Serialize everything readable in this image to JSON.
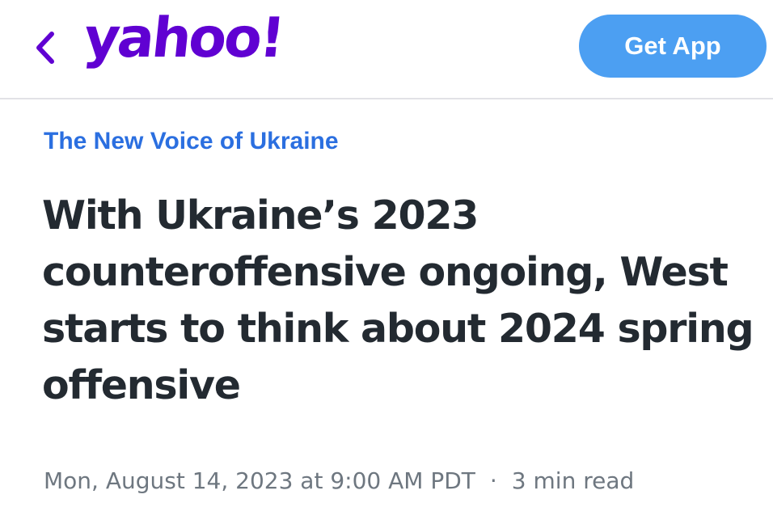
{
  "header": {
    "back_icon": "chevron-left-icon",
    "logo_text": "yahoo!",
    "get_app_label": "Get App",
    "colors": {
      "brand": "#6001d2",
      "button": "#4c9ff2"
    }
  },
  "article": {
    "publisher": "The New Voice of Ukraine",
    "title": "With Ukraine’s 2023 counteroffensive ongoing, West starts to think about 2024 spring offensive",
    "date": "Mon, August 14, 2023 at 9:00 AM PDT",
    "separator": "·",
    "read_time": "3 min read",
    "colors": {
      "publisher": "#2b6fe0",
      "title": "#232a31",
      "meta": "#6e7780"
    }
  }
}
